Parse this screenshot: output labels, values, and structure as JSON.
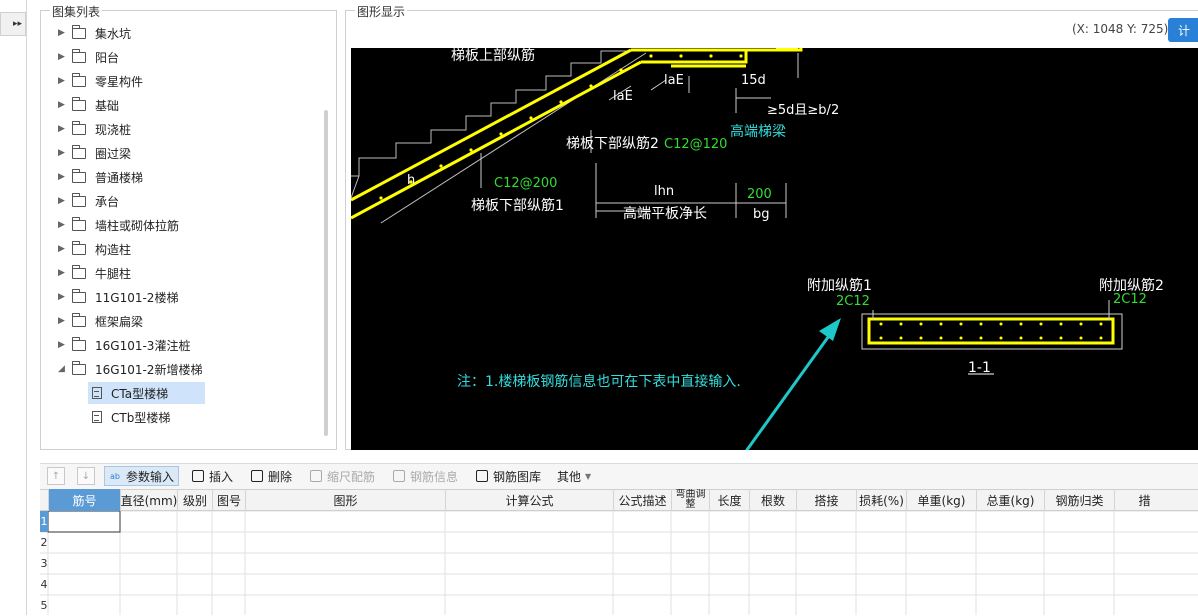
{
  "tree": {
    "title": "图集列表",
    "items": [
      {
        "label": "集水坑"
      },
      {
        "label": "阳台"
      },
      {
        "label": "零星构件"
      },
      {
        "label": "基础"
      },
      {
        "label": "现浇桩"
      },
      {
        "label": "圈过梁"
      },
      {
        "label": "普通楼梯"
      },
      {
        "label": "承台"
      },
      {
        "label": "墙柱或砌体拉筋"
      },
      {
        "label": "构造柱"
      },
      {
        "label": "牛腿柱"
      },
      {
        "label": "11G101-2楼梯"
      },
      {
        "label": "框架扁梁"
      },
      {
        "label": "16G101-3灌注桩"
      },
      {
        "label": "16G101-2新增楼梯"
      }
    ],
    "children": [
      {
        "label": "CTa型楼梯",
        "selected": true
      },
      {
        "label": "CTb型楼梯",
        "selected": false
      }
    ]
  },
  "drawing": {
    "title": "图形显示",
    "coord": "(X: 1048 Y: 725)",
    "calc_label": "计",
    "labels": {
      "top_bar": "梯板上部纵筋",
      "lae1": "laE",
      "lae2": "laE",
      "d15": "15d",
      "cond": "≥5d且≥b/2",
      "bottom2": "梯板下部纵筋2",
      "bottom2_spec": "C12@120",
      "high_beam": "高端梯梁",
      "h": "h",
      "bottom1_spec": "C12@200",
      "bottom1": "梯板下部纵筋1",
      "lhn": "lhn",
      "lhn_desc": "高端平板净长",
      "bg_val": "200",
      "bg": "bg",
      "add1": "附加纵筋1",
      "add1_spec": "2C12",
      "add2": "附加纵筋2",
      "add2_spec": "2C12",
      "section": "1-1",
      "note": "注：1.楼梯板钢筋信息也可在下表中直接输入."
    }
  },
  "toolbar": {
    "up": "↑",
    "down": "↓",
    "param": "参数输入",
    "insert": "插入",
    "delete": "删除",
    "scale": "缩尺配筋",
    "info": "钢筋信息",
    "library": "钢筋图库",
    "other": "其他"
  },
  "grid": {
    "columns": [
      "筋号",
      "直径(mm)",
      "级别",
      "图号",
      "图形",
      "计算公式",
      "公式描述",
      "弯曲调整",
      "长度",
      "根数",
      "搭接",
      "损耗(%)",
      "单重(kg)",
      "总重(kg)",
      "钢筋归类",
      "措"
    ],
    "rows": [
      "1",
      "2",
      "3",
      "4",
      "5"
    ]
  },
  "colors": {
    "accent": "#2a7fd6",
    "rebar": "#ffff00",
    "canvas": "#000000",
    "green_text": "#33dd33",
    "cyan_text": "#33dddd",
    "arrow": "#1fc8c8"
  }
}
